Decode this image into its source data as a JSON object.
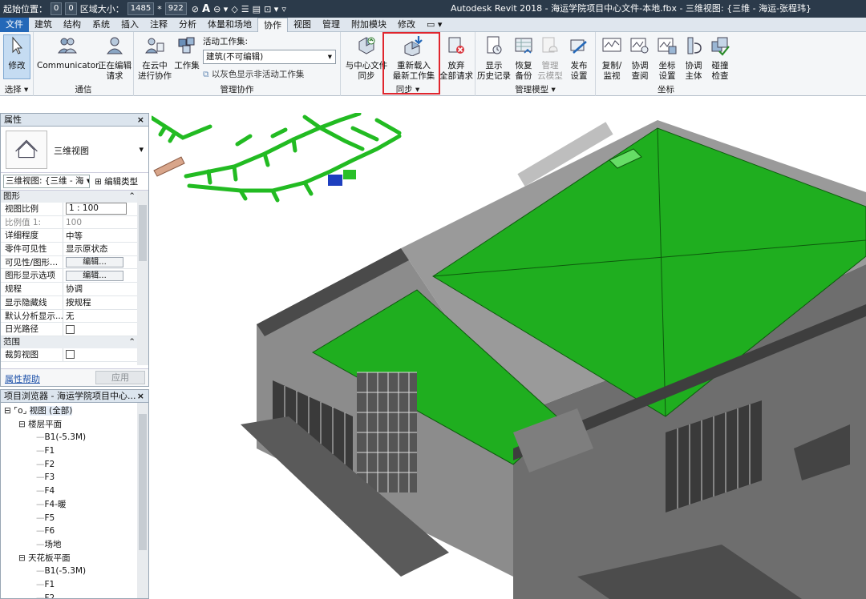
{
  "quick_access": {
    "start_pos": "起始位置：",
    "val1": "0",
    "val2": "0",
    "area_label": "区域大小：",
    "area_w": "1485",
    "area_h": "922"
  },
  "title": "Autodesk Revit 2018 -     海运学院项目中心文件-本地.fbx - 三维视图: {三维 - 海运-张程玮}",
  "menu": [
    "文件",
    "建筑",
    "结构",
    "系统",
    "插入",
    "注释",
    "分析",
    "体量和场地",
    "协作",
    "视图",
    "管理",
    "附加模块",
    "修改"
  ],
  "ribbon": {
    "modify": "修改",
    "select": "选择 ▾",
    "communicator": "Communicator",
    "editing_requests": [
      "正在编辑",
      "请求"
    ],
    "comm_group": "通信",
    "collab_cloud": [
      "在云中",
      "进行协作"
    ],
    "worksets": "工作集",
    "active_workset_label": "活动工作集:",
    "active_workset_value": "建筑(不可编辑)",
    "gray_inactive": "以灰色显示非活动工作集",
    "manage_collab_group": "管理协作",
    "sync_central": [
      "与中心文件",
      "同步"
    ],
    "reload_latest": [
      "重新载入",
      "最新工作集"
    ],
    "relinquish": [
      "放弃",
      "全部请求"
    ],
    "sync_group": "同步 ▾",
    "show_history": [
      "显示",
      "历史记录"
    ],
    "restore_backup": [
      "恢复",
      "备份"
    ],
    "manage_cloud": [
      "管理",
      "云模型"
    ],
    "publish_settings": [
      "发布",
      "设置"
    ],
    "manage_models_group": "管理模型 ▾",
    "copy_monitor": [
      "复制/",
      "监视"
    ],
    "coord_review": [
      "协调",
      "查阅"
    ],
    "coord_settings": [
      "坐标",
      "设置"
    ],
    "coord_host": [
      "协调",
      "主体"
    ],
    "clash_check": [
      "碰撞",
      "检查"
    ],
    "coord_group": "坐标"
  },
  "properties": {
    "header": "属性",
    "type_name": "三维视图",
    "view_selector": "三维视图: {三维 - 海",
    "edit_type": "编辑类型",
    "section_graphics": "图形",
    "rows": [
      {
        "k": "视图比例",
        "v": "1 : 100"
      },
      {
        "k": "比例值 1:",
        "v": "100"
      },
      {
        "k": "详细程度",
        "v": "中等"
      },
      {
        "k": "零件可见性",
        "v": "显示原状态"
      },
      {
        "k": "可见性/图形...",
        "v": "编辑..."
      },
      {
        "k": "图形显示选项",
        "v": "编辑..."
      },
      {
        "k": "规程",
        "v": "协调"
      },
      {
        "k": "显示隐藏线",
        "v": "按规程"
      },
      {
        "k": "默认分析显示...",
        "v": "无"
      },
      {
        "k": "日光路径",
        "v": ""
      }
    ],
    "section_extents": "范围",
    "crop_view": "裁剪视图",
    "help_link": "属性帮助",
    "apply": "应用"
  },
  "browser": {
    "header": "项目浏览器 - 海运学院项目中心...",
    "root": "视图 (全部)",
    "floor_plans": "楼层平面",
    "floors": [
      "B1(-5.3M)",
      "F1",
      "F2",
      "F3",
      "F4",
      "F4-暖",
      "F5",
      "F6",
      "场地"
    ],
    "ceiling_plans": "天花板平面",
    "ceilings": [
      "B1(-5.3M)",
      "F1",
      "F2"
    ]
  },
  "colors": {
    "roof": "#1fae1f",
    "wall": "#7a7a7a",
    "pipe": "#22cc22",
    "highlight": "#e0262e"
  }
}
